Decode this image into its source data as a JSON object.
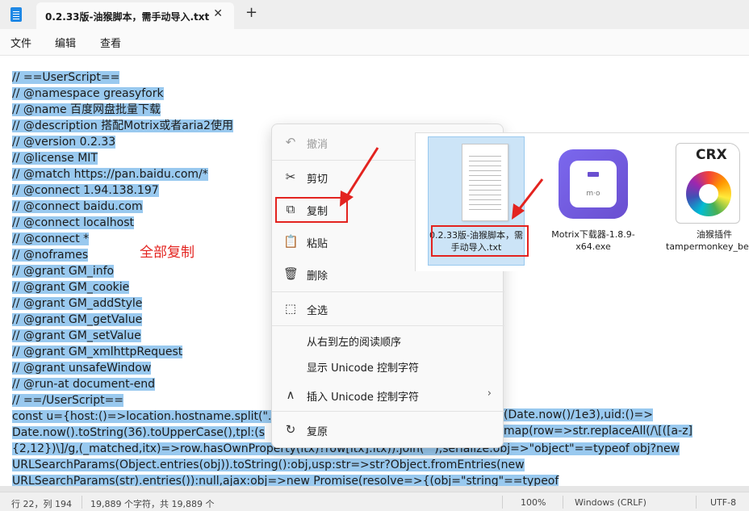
{
  "window": {
    "tab_title": "0.2.33版-油猴脚本，需手动导入.txt",
    "tab_close": "✕",
    "new_tab": "+"
  },
  "menu": {
    "file": "文件",
    "edit": "编辑",
    "view": "查看"
  },
  "editor": {
    "lines": [
      "// ==UserScript==",
      "// @namespace greasyfork",
      "// @name 百度网盘批量下载",
      "// @description 搭配Motrix或者aria2使用",
      "// @version 0.2.33",
      "// @license MIT",
      "// @match https://pan.baidu.com/*",
      "// @connect 1.94.138.197",
      "// @connect baidu.com",
      "// @connect localhost",
      "// @connect *",
      "// @noframes",
      "// @grant GM_info",
      "// @grant GM_cookie",
      "// @grant GM_addStyle",
      "// @grant GM_getValue",
      "// @grant GM_setValue",
      "// @grant GM_xmlhttpRequest",
      "// @grant unsafeWindow",
      "// @run-at document-end",
      "// ==/UserScript==",
      "const u={host:()=>location.hostname.split(\".",
      "Date.now().toString(36).toUpperCase(),tpl:(s",
      "{2,12})\\]/g,(_matched,itx)=>row.hasOwnProperty(itx)?row[itx]:itx)).join(\"\"),serialize:obj=>\"object\"==typeof obj?new",
      "URLSearchParams(Object.entries(obj)).toString():obj,usp:str=>str?Object.fromEntries(new",
      "URLSearchParams(str).entries()):null,ajax:obj=>new Promise(resolve=>{(obj=\"string\"==typeof"
    ],
    "line22_tail": "(Date.now()/1e3),uid:()=>",
    "line23_tail": "map(row=>str.replaceAll(/\\[([a-z]",
    "annotation": "全部复制"
  },
  "context_menu": {
    "undo": "撤消",
    "cut": "剪切",
    "copy": "复制",
    "paste": "粘贴",
    "delete": "删除",
    "select_all": "全选",
    "rtl": "从右到左的阅读顺序",
    "show_unicode": "显示 Unicode 控制字符",
    "insert_unicode": "插入 Unicode 控制字符",
    "reconvert": "复原"
  },
  "files": {
    "txt_name": "0.2.33版-油猴脚本，需手动导入.txt",
    "motrix_name": "Motrix下载器-1.8.9-x64.exe",
    "crx_name": "油猴插件tampermonkey_beta.crx",
    "crx_label": "CRX",
    "motrix_mark": "m·o"
  },
  "status": {
    "position": "行 22，列 194",
    "chars": "19,889 个字符，共 19,889 个",
    "zoom": "100%",
    "eol": "Windows (CRLF)",
    "encoding": "UTF-8"
  },
  "colors": {
    "selection": "#99c9ef",
    "annotation_red": "#e3231f"
  }
}
